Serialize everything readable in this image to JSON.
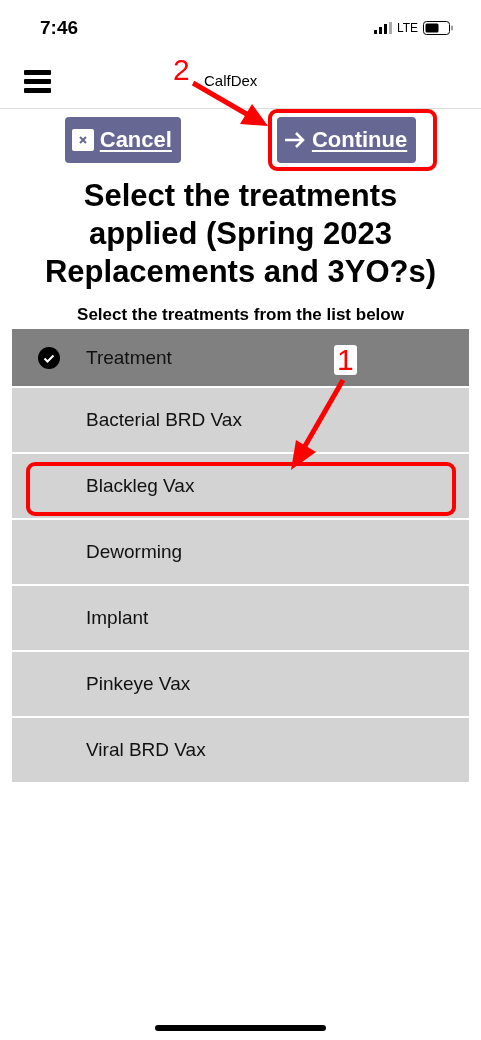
{
  "status_bar": {
    "time": "7:46",
    "network": "LTE"
  },
  "nav_bar": {
    "title": "CalfDex"
  },
  "buttons": [
    {
      "label": "Cancel",
      "kind": "cancel",
      "highlighted": false
    },
    {
      "label": "Continue",
      "kind": "continue",
      "highlighted": true
    }
  ],
  "title": "Select the treatments applied (Spring 2023 Replacements and 3YO?s)",
  "subtitle": "Select the treatments from the list below",
  "list": {
    "header": {
      "label": "Treatment",
      "checked": true
    },
    "items": [
      {
        "label": "Bacterial BRD Vax",
        "highlighted": false
      },
      {
        "label": "Blackleg Vax",
        "highlighted": true
      },
      {
        "label": "Deworming",
        "highlighted": false
      },
      {
        "label": "Implant",
        "highlighted": false
      },
      {
        "label": "Pinkeye Vax",
        "highlighted": false
      },
      {
        "label": "Viral BRD Vax",
        "highlighted": false
      }
    ]
  },
  "annotations": [
    {
      "number": "1"
    },
    {
      "number": "2"
    }
  ]
}
